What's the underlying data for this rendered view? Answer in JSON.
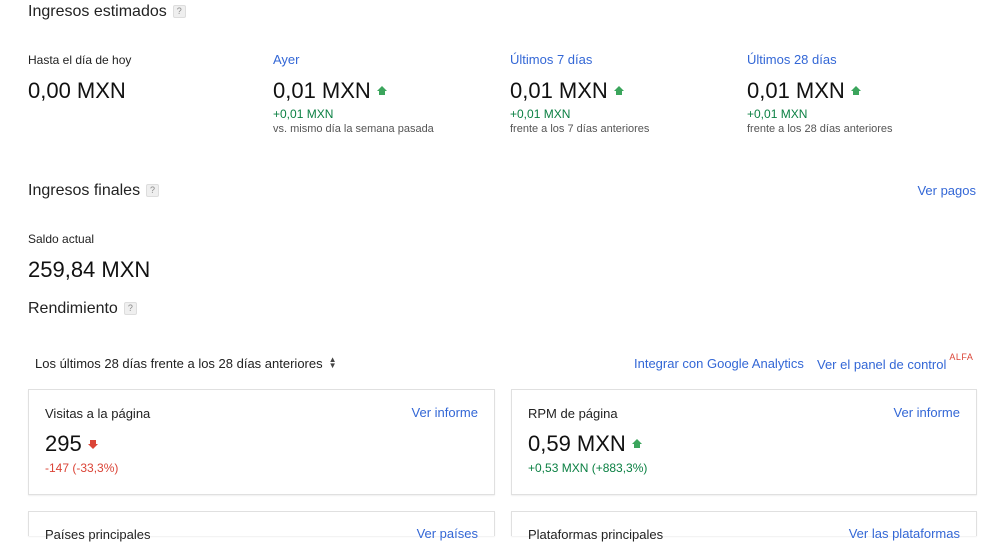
{
  "estimated": {
    "title": "Ingresos estimados",
    "help": "?",
    "cols": [
      {
        "label": "Hasta el día de hoy",
        "value": "0,00 MXN",
        "delta": "",
        "compare": ""
      },
      {
        "label": "Ayer",
        "value": "0,01 MXN",
        "delta": "+0,01 MXN",
        "compare": "vs. mismo día la semana pasada"
      },
      {
        "label": "Últimos 7 días",
        "value": "0,01 MXN",
        "delta": "+0,01 MXN",
        "compare": "frente a los 7 días anteriores"
      },
      {
        "label": "Últimos 28 días",
        "value": "0,01 MXN",
        "delta": "+0,01 MXN",
        "compare": "frente a los 28 días anteriores"
      }
    ]
  },
  "final": {
    "title": "Ingresos finales",
    "help": "?",
    "payments_link": "Ver pagos",
    "balance_label": "Saldo actual",
    "balance_value": "259,84 MXN"
  },
  "performance": {
    "title": "Rendimiento",
    "help": "?",
    "range_selector": "Los últimos 28 días frente a los 28 días anteriores",
    "analytics_link": "Integrar con Google Analytics",
    "dashboard_link": "Ver el panel de control",
    "dashboard_badge": "ALFA",
    "cards": [
      {
        "title": "Visitas a la página",
        "link": "Ver informe",
        "value": "295",
        "delta": "-147 (-33,3%)"
      },
      {
        "title": "RPM de página",
        "link": "Ver informe",
        "value": "0,59 MXN",
        "delta": "+0,53 MXN (+883,3%)"
      },
      {
        "title": "Países principales",
        "link": "Ver países"
      },
      {
        "title": "Plataformas principales",
        "link": "Ver las plataformas"
      }
    ]
  },
  "colors": {
    "link": "#3367d6",
    "positive": "#0b8043",
    "negative": "#db4437",
    "up_arrow": "#3ba55c"
  },
  "icons": {
    "up": "arrow-up-icon",
    "down": "arrow-down-icon",
    "help": "help-icon",
    "sort": "sort-icon"
  }
}
